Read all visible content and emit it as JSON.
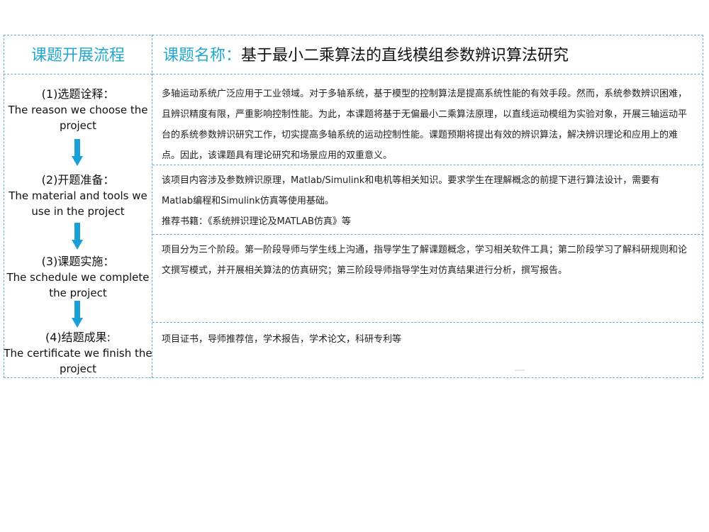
{
  "header": {
    "left_title": "课题开展流程",
    "right_label": "课题名称：",
    "right_title": "基于最小二乘算法的直线模组参数辨识算法研究"
  },
  "steps": [
    {
      "cn": "(1)选题诠释：",
      "en": "The reason we choose the project"
    },
    {
      "cn": "(2)开题准备：",
      "en": "The material and tools we use in the project"
    },
    {
      "cn": "(3)课题实施：",
      "en": "The schedule we complete the project"
    },
    {
      "cn": "(4)结题成果:",
      "en": "The certificate we finish the project"
    }
  ],
  "contents": [
    "多轴运动系统广泛应用于工业领域。对于多轴系统，基于模型的控制算法是提高系统性能的有效手段。然而，系统参数辨识困难，且辨识精度有限，严重影响控制性能。为此，本课题将基于无偏最小二乘算法原理，以直线运动模组为实验对象，开展三轴运动平台的系统参数辨识研究工作，切实提高多轴系统的运动控制性能。课题预期将提出有效的辨识算法，解决辨识理论和应用上的难点。因此，该课题具有理论研究和场景应用的双重意义。",
    "该项目内容涉及参数辨识原理，Matlab/Simulink和电机等相关知识。要求学生在理解概念的前提下进行算法设计，需要有Matlab编程和Simulink仿真等使用基础。",
    "推荐书籍：《系统辨识理论及MATLAB仿真》等",
    "项目分为三个阶段。第一阶段导师与学生线上沟通，指导学生了解课题概念，学习相关软件工具；第二阶段学习了解科研规则和论文撰写模式，并开展相关算法的仿真研究；第三阶段导师指导学生对仿真结果进行分析，撰写报告。",
    "项目证书，导师推荐信，学术报告，学术论文，科研专利等"
  ],
  "colors": {
    "accent": "#22a8cf",
    "arrow": "#1aa0d8",
    "border": "#6aa9d8"
  }
}
